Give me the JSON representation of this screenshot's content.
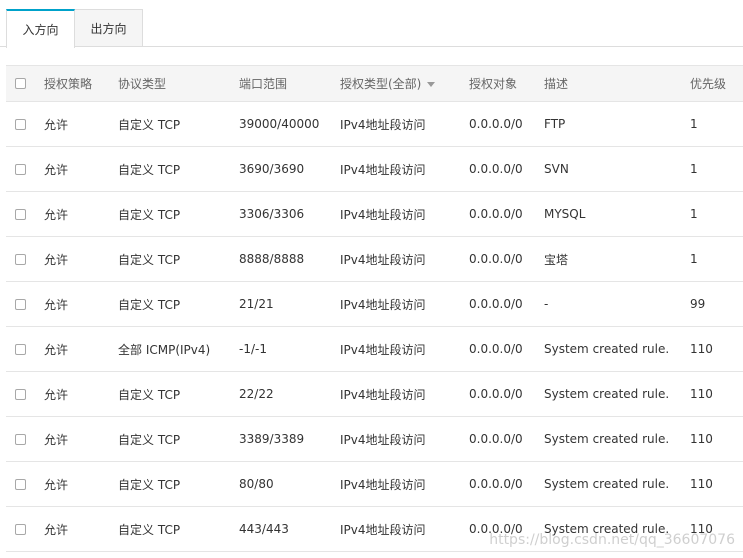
{
  "tabs": [
    {
      "label": "入方向",
      "active": true
    },
    {
      "label": "出方向",
      "active": false
    }
  ],
  "columns": {
    "policy": "授权策略",
    "protocol": "协议类型",
    "port_range": "端口范围",
    "auth_type": "授权类型(全部)",
    "auth_object": "授权对象",
    "description": "描述",
    "priority": "优先级"
  },
  "rows": [
    {
      "policy": "允许",
      "protocol": "自定义 TCP",
      "port_range": "39000/40000",
      "auth_type": "IPv4地址段访问",
      "auth_object": "0.0.0.0/0",
      "description": "FTP",
      "priority": "1"
    },
    {
      "policy": "允许",
      "protocol": "自定义 TCP",
      "port_range": "3690/3690",
      "auth_type": "IPv4地址段访问",
      "auth_object": "0.0.0.0/0",
      "description": "SVN",
      "priority": "1"
    },
    {
      "policy": "允许",
      "protocol": "自定义 TCP",
      "port_range": "3306/3306",
      "auth_type": "IPv4地址段访问",
      "auth_object": "0.0.0.0/0",
      "description": "MYSQL",
      "priority": "1"
    },
    {
      "policy": "允许",
      "protocol": "自定义 TCP",
      "port_range": "8888/8888",
      "auth_type": "IPv4地址段访问",
      "auth_object": "0.0.0.0/0",
      "description": "宝塔",
      "priority": "1"
    },
    {
      "policy": "允许",
      "protocol": "自定义 TCP",
      "port_range": "21/21",
      "auth_type": "IPv4地址段访问",
      "auth_object": "0.0.0.0/0",
      "description": "-",
      "priority": "99"
    },
    {
      "policy": "允许",
      "protocol": "全部 ICMP(IPv4)",
      "port_range": "-1/-1",
      "auth_type": "IPv4地址段访问",
      "auth_object": "0.0.0.0/0",
      "description": "System created rule.",
      "priority": "110"
    },
    {
      "policy": "允许",
      "protocol": "自定义 TCP",
      "port_range": "22/22",
      "auth_type": "IPv4地址段访问",
      "auth_object": "0.0.0.0/0",
      "description": "System created rule.",
      "priority": "110"
    },
    {
      "policy": "允许",
      "protocol": "自定义 TCP",
      "port_range": "3389/3389",
      "auth_type": "IPv4地址段访问",
      "auth_object": "0.0.0.0/0",
      "description": "System created rule.",
      "priority": "110"
    },
    {
      "policy": "允许",
      "protocol": "自定义 TCP",
      "port_range": "80/80",
      "auth_type": "IPv4地址段访问",
      "auth_object": "0.0.0.0/0",
      "description": "System created rule.",
      "priority": "110"
    },
    {
      "policy": "允许",
      "protocol": "自定义 TCP",
      "port_range": "443/443",
      "auth_type": "IPv4地址段访问",
      "auth_object": "0.0.0.0/0",
      "description": "System created rule.",
      "priority": "110"
    }
  ],
  "watermark": "https://blog.csdn.net/qq_36607076",
  "colors": {
    "accent": "#00a2ca",
    "header_bg": "#f5f5f5",
    "border": "#e5e5e5"
  }
}
